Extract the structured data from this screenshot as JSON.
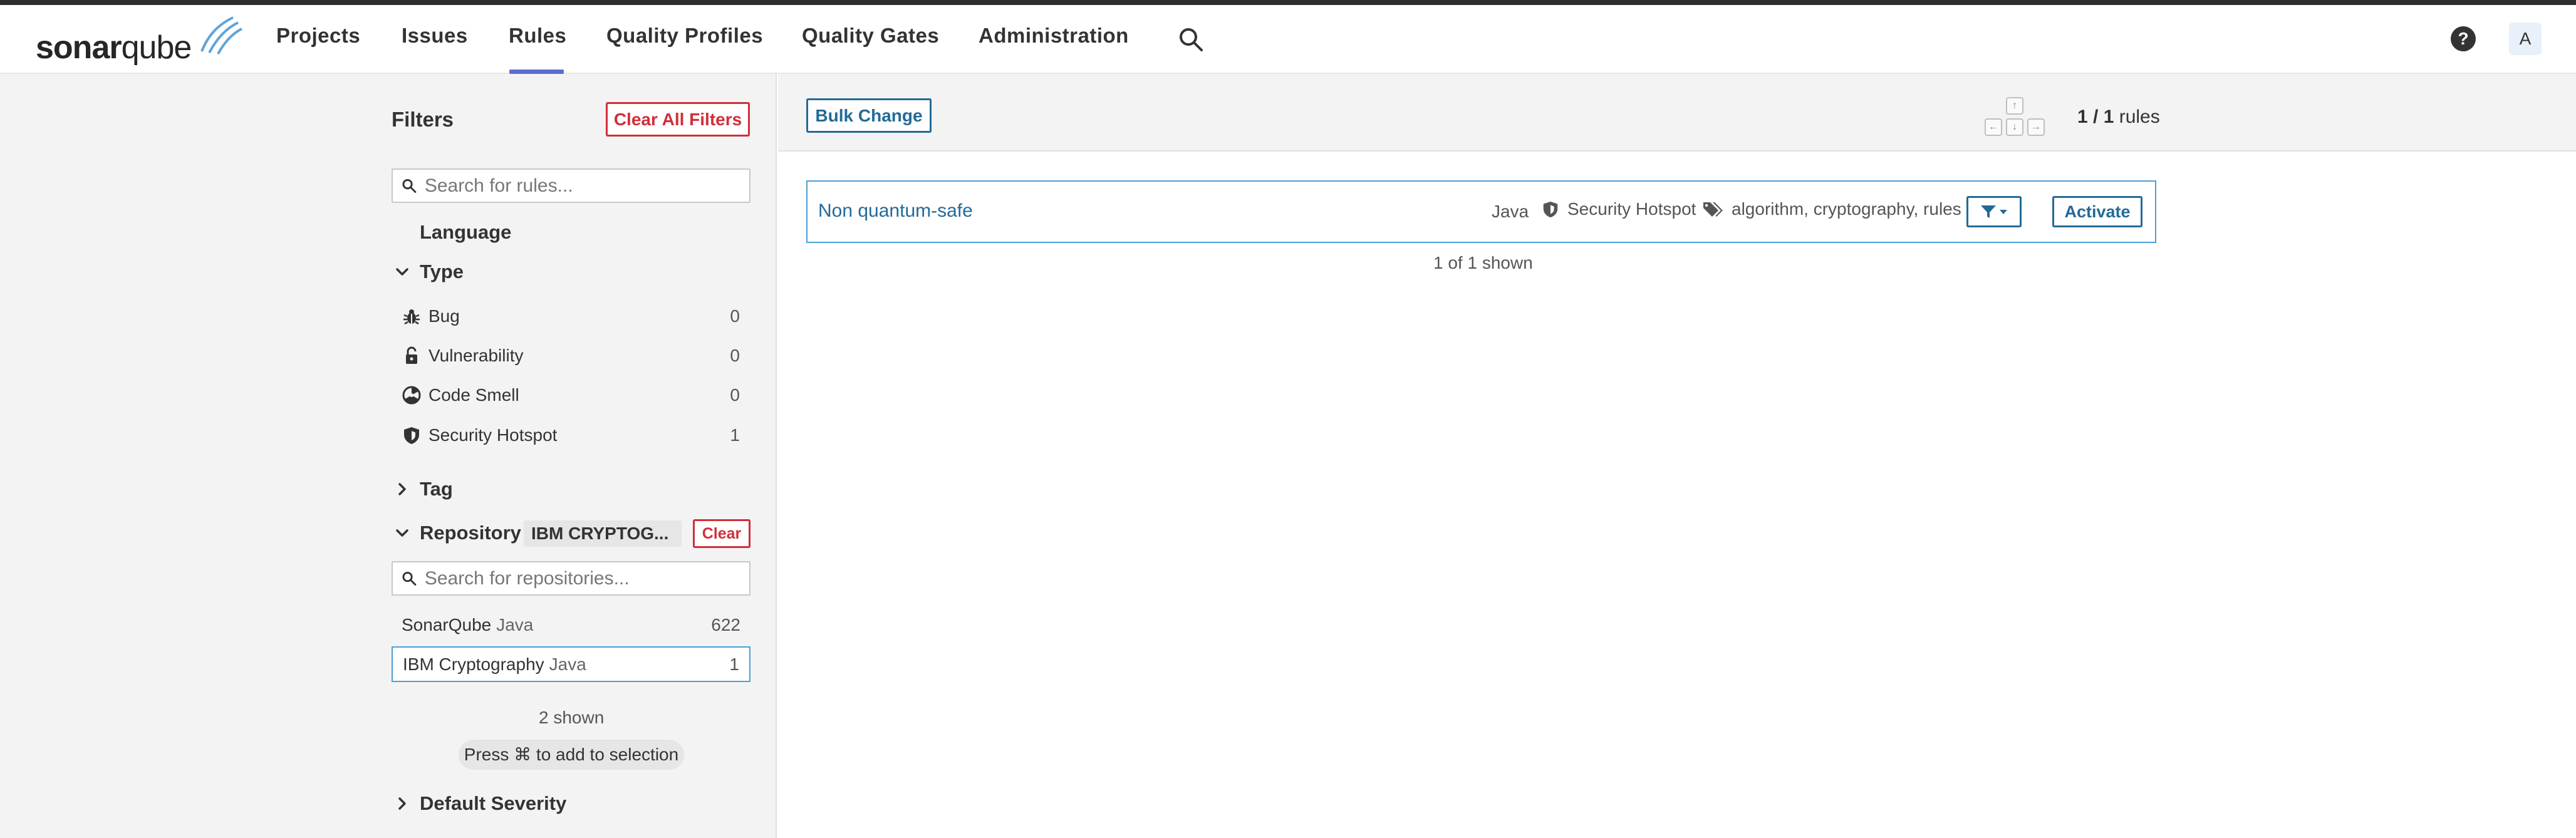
{
  "brand": {
    "name_bold": "sonar",
    "name_light": "qube"
  },
  "nav": {
    "items": [
      {
        "label": "Projects"
      },
      {
        "label": "Issues"
      },
      {
        "label": "Rules"
      },
      {
        "label": "Quality Profiles"
      },
      {
        "label": "Quality Gates"
      },
      {
        "label": "Administration"
      }
    ],
    "active": "Rules",
    "avatar_letter": "A",
    "help_label": "?"
  },
  "filters": {
    "title": "Filters",
    "clear_all_label": "Clear All Filters",
    "search_placeholder": "Search for rules...",
    "language_label": "Language",
    "type": {
      "label": "Type",
      "items": [
        {
          "label": "Bug",
          "count": "0",
          "icon": "bug-icon"
        },
        {
          "label": "Vulnerability",
          "count": "0",
          "icon": "lock-icon"
        },
        {
          "label": "Code Smell",
          "count": "0",
          "icon": "code-smell-icon"
        },
        {
          "label": "Security Hotspot",
          "count": "1",
          "icon": "shield-icon"
        }
      ]
    },
    "tag_label": "Tag",
    "repository": {
      "label": "Repository",
      "selected_badge": "IBM CRYPTOG...",
      "clear_label": "Clear",
      "search_placeholder": "Search for repositories...",
      "items": [
        {
          "name": "SonarQube",
          "qualifier": "Java",
          "count": "622",
          "selected": false
        },
        {
          "name": "IBM Cryptography",
          "qualifier": "Java",
          "count": "1",
          "selected": true
        }
      ],
      "shown": "2 shown",
      "hint": "Press ⌘ to add to selection"
    },
    "default_severity_label": "Default Severity"
  },
  "main": {
    "bulk_change_label": "Bulk Change",
    "keys": {
      "up": "↑",
      "left": "←",
      "down": "↓",
      "right": "→"
    },
    "paging": {
      "current": "1 / 1",
      "unit": "rules"
    },
    "rules": [
      {
        "title": "Non quantum-safe",
        "language": "Java",
        "type": "Security Hotspot",
        "tags": "algorithm, cryptography, rules",
        "activate_label": "Activate"
      }
    ],
    "shown": "1 of 1 shown"
  },
  "colors": {
    "link_blue": "#236a97",
    "danger_red": "#d02f3a",
    "nav_active": "#5d6cd0",
    "selected_border": "#4b9fd5"
  }
}
